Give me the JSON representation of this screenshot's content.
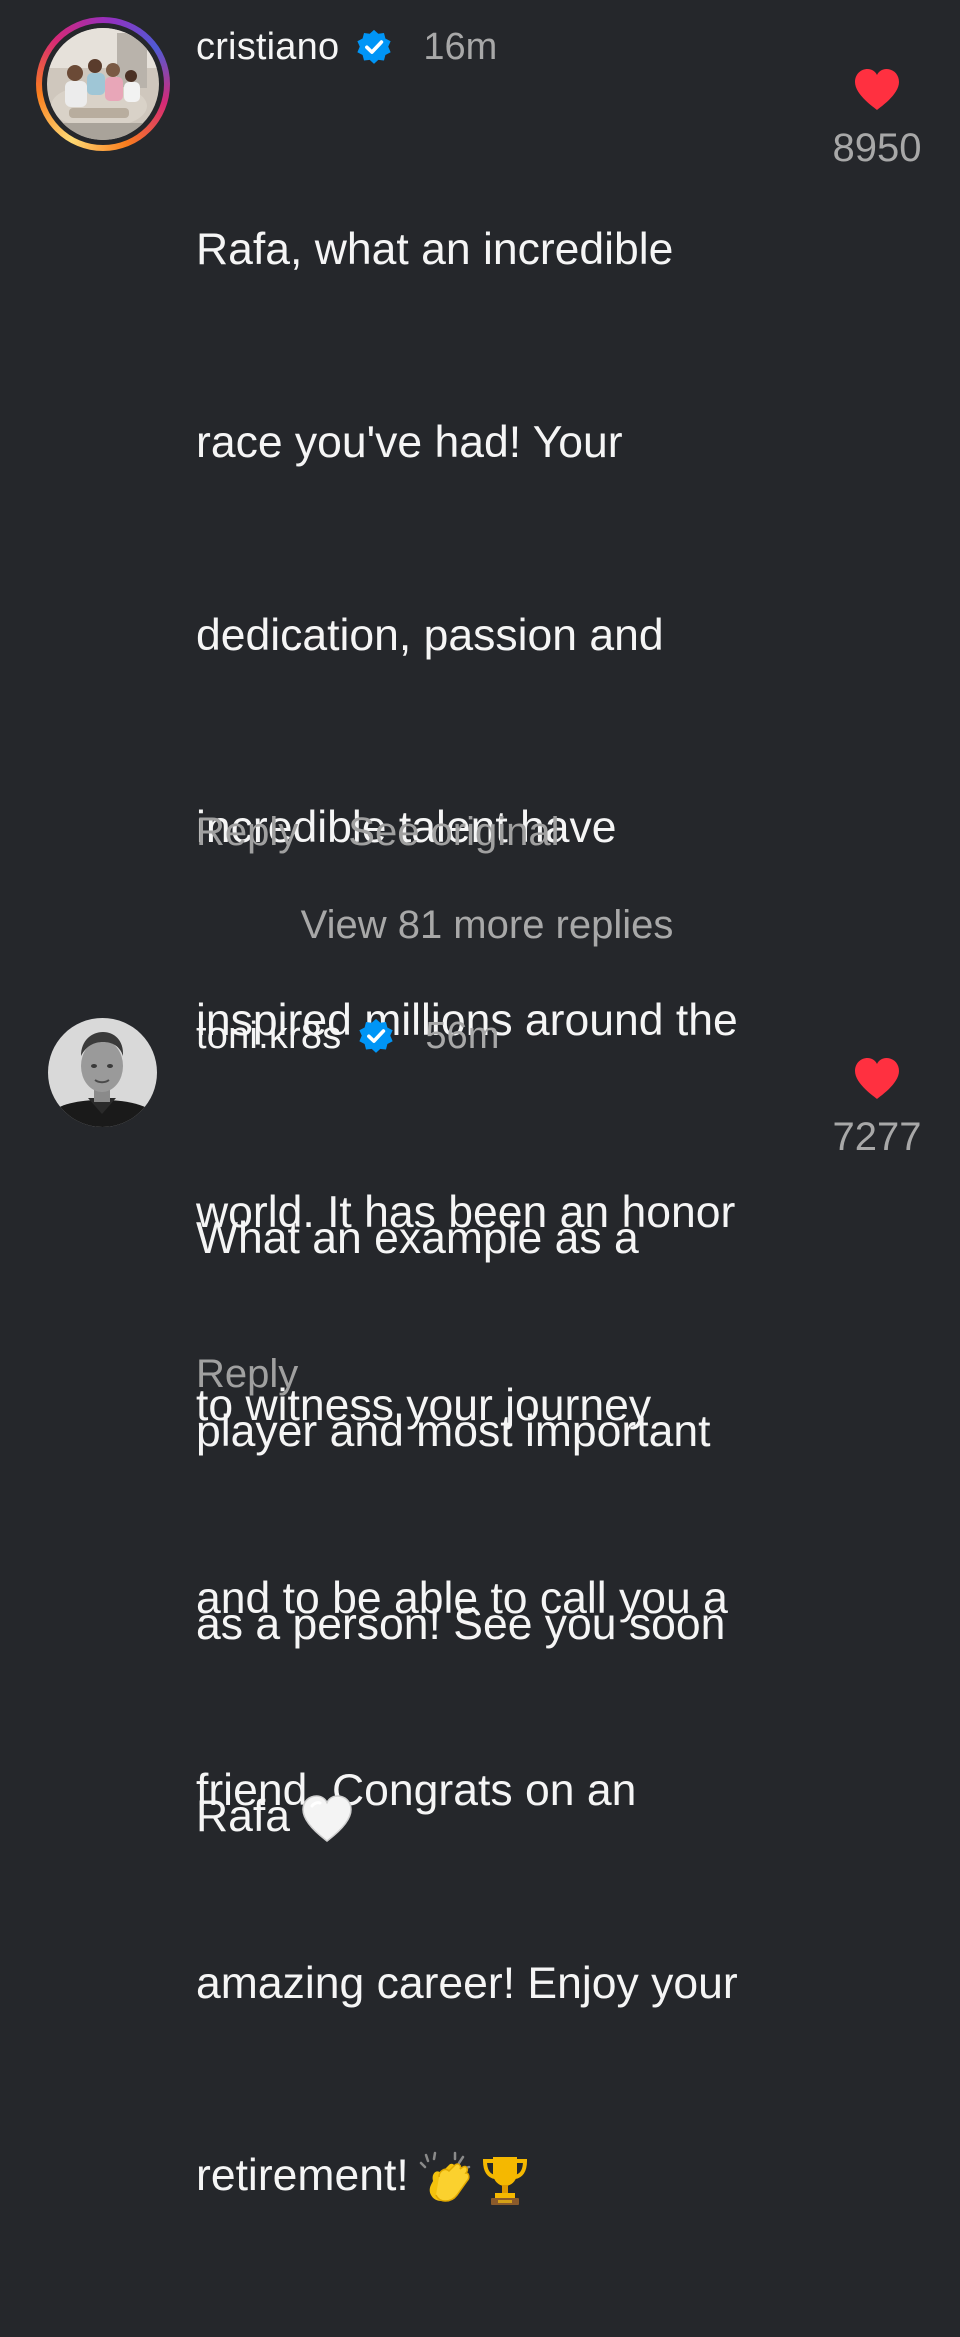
{
  "comments": [
    {
      "username": "cristiano",
      "verified": true,
      "time": "16m",
      "lines": [
        "Rafa, what an incredible",
        "race you've had! Your",
        "dedication, passion and",
        "incredible talent have",
        "inspired millions around the",
        "world. It has been an honor",
        "to witness your journey",
        "and to be able to call you a",
        "friend. Congrats on an",
        "amazing career! Enjoy your",
        "retirement!"
      ],
      "end_emojis": [
        "clapping-hands",
        "trophy"
      ],
      "actions": [
        "Reply",
        "See original"
      ],
      "likes": "8950",
      "liked": true
    },
    {
      "username": "toni.kr8s",
      "verified": true,
      "time": "56m",
      "lines": [
        "What an example as a",
        "player and most important",
        "as a person! See you soon",
        "Rafa"
      ],
      "end_emojis": [
        "white-heart"
      ],
      "actions": [
        "Reply"
      ],
      "likes": "7277",
      "liked": true
    }
  ],
  "view_more_replies": "View 81 more replies",
  "colors": {
    "background": "#25272b",
    "text": "#f5f5f5",
    "muted": "#a8a8a8",
    "like_red": "#ff3040",
    "verified_blue": "#0095f6"
  }
}
